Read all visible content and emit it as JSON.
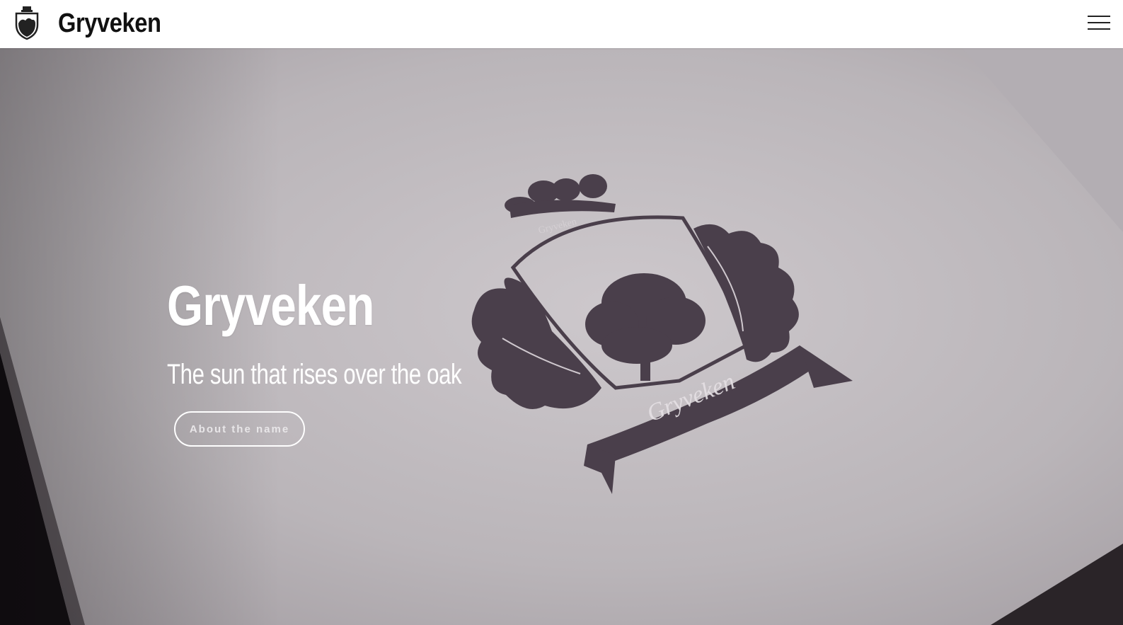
{
  "navbar": {
    "brand_name": "Gryveken",
    "logo_icon": "crest-logo-icon",
    "menu_icon": "hamburger-menu-icon"
  },
  "hero": {
    "title": "Gryveken",
    "subtitle": "The sun that rises over the oak",
    "button_label": "About the name",
    "emblem_banner_text": "Gryveken",
    "emblem_crown_text": "Gryveken",
    "emblem_icon": "oak-crest-emblem",
    "colors": {
      "paper": "#bdb8bc",
      "emblem": "#4a3f4b",
      "text": "#ffffff"
    }
  }
}
